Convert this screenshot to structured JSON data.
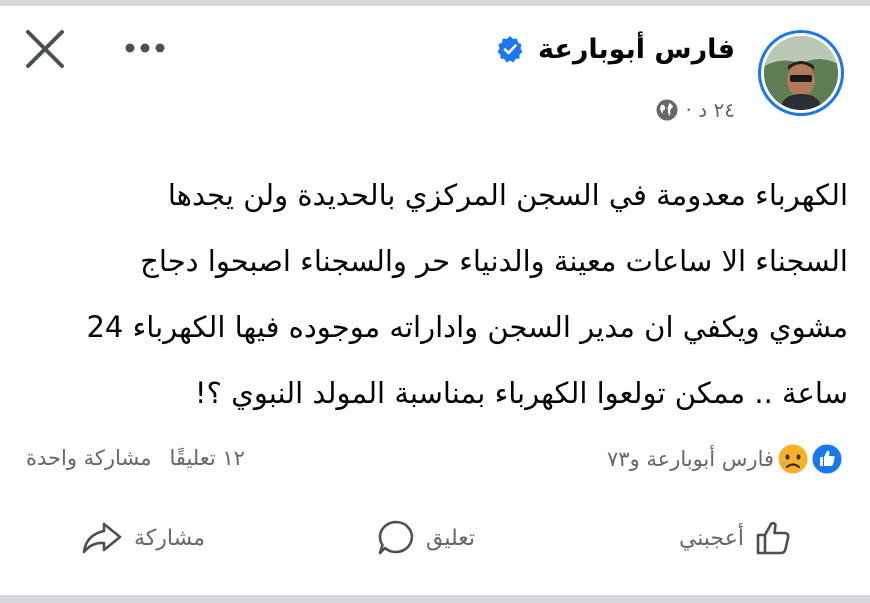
{
  "post": {
    "author": "فارس أبوبارعة",
    "time": "٢٤ د ·",
    "text_lines": [
      "الكهرباء معدومة في السجن المركزي بالحديدة ولن يجدها",
      "السجناء الا ساعات معينة والدنياء حر والسجناء اصبحوا دجاج",
      "مشوي ويكفي ان مدير السجن واداراته موجوده فيها الكهرباء 24",
      "ساعة .. ممكن تولعوا الكهرباء بمناسبة المولد النبوي ؟!"
    ]
  },
  "reactions": {
    "text": "فارس أبوبارعة و٧٣",
    "comments": "١٢ تعليقًا",
    "shares": "مشاركة واحدة"
  },
  "actions": {
    "like": "أعجبني",
    "comment": "تعليق",
    "share": "مشاركة"
  },
  "icons": {
    "close": "close-icon",
    "more": "more-icon",
    "verified": "verified-badge-icon",
    "globe": "globe-icon",
    "like_reaction": "like-reaction-icon",
    "sad_reaction": "sad-reaction-icon",
    "like_action": "thumb-up-icon",
    "comment_action": "comment-icon",
    "share_action": "share-icon"
  },
  "colors": {
    "accent": "#1877f2",
    "secondary_text": "#65676b",
    "sad": "#f7b125"
  }
}
